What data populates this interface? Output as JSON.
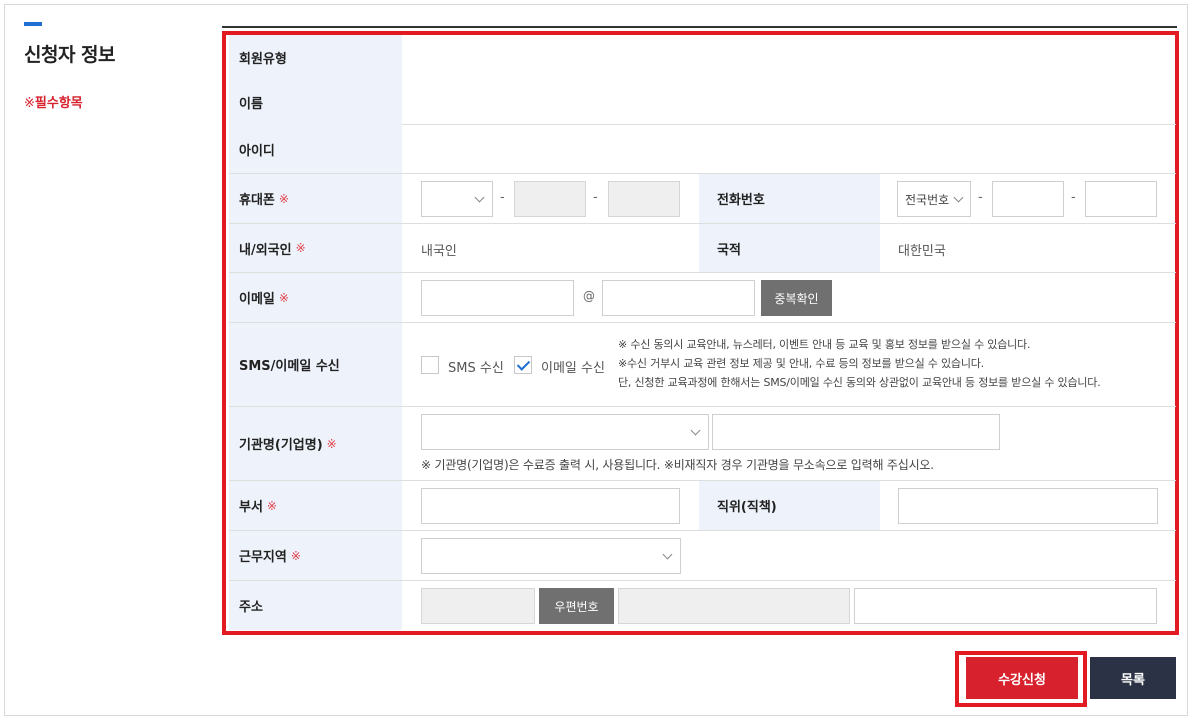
{
  "section": {
    "title": "신청자 정보",
    "required_note": "필수항목",
    "required_mark": "※"
  },
  "fields": {
    "member_type": {
      "label": "회원유형"
    },
    "name": {
      "label": "이름"
    },
    "user_id": {
      "label": "아이디"
    },
    "mobile": {
      "label": "휴대폰",
      "separator": "-"
    },
    "phone": {
      "label": "전화번호",
      "area_select": "전국번호",
      "separator": "-"
    },
    "nationality_type": {
      "label": "내/외국인",
      "value": "내국인"
    },
    "country": {
      "label": "국적",
      "value": "대한민국"
    },
    "email": {
      "label": "이메일",
      "at": "@",
      "dup_check_button": "중복확인"
    },
    "consent": {
      "label": "SMS/이메일 수신",
      "sms_label": "SMS 수신",
      "sms_checked": false,
      "email_label": "이메일 수신",
      "email_checked": true,
      "notes": [
        "※ 수신 동의시 교육안내, 뉴스레터, 이벤트 안내 등 교육 및 홍보 정보를 받으실 수 있습니다.",
        "※수신 거부시 교육 관련 정보 제공 및 안내, 수료 등의 정보를 받으실 수 있습니다.",
        "단, 신청한 교육과정에 한해서는 SMS/이메일 수신 동의와 상관없이 교육안내 등 정보를 받으실 수 있습니다."
      ]
    },
    "organization": {
      "label": "기관명(기업명)",
      "note": "※ 기관명(기업명)은 수료증 출력 시, 사용됩니다. ※비재직자 경우 기관명을 무소속으로 입력해 주십시오."
    },
    "department": {
      "label": "부서"
    },
    "position": {
      "label": "직위(직책)"
    },
    "work_region": {
      "label": "근무지역"
    },
    "address": {
      "label": "주소",
      "zipcode_button": "우편번호"
    }
  },
  "actions": {
    "submit": "수강신청",
    "list": "목록"
  },
  "colors": {
    "accent_red": "#e21b23",
    "label_bg": "#eef3fb",
    "primary_blue": "#1f6fd1",
    "navy_button": "#2c3245"
  }
}
